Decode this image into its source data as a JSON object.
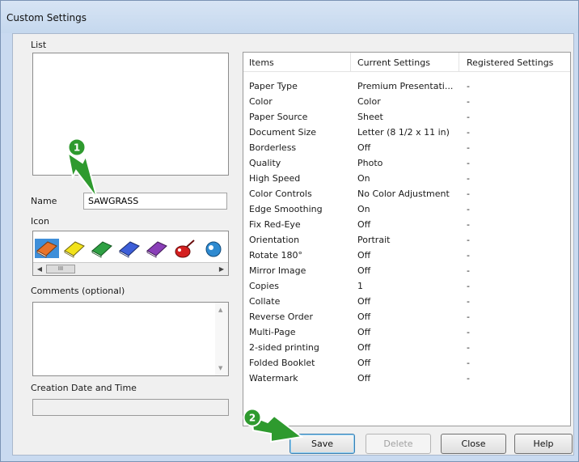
{
  "window": {
    "title": "Custom Settings"
  },
  "left_panel": {
    "list_label": "List",
    "name_label": "Name",
    "name_value": "SAWGRASS",
    "icon_label": "Icon",
    "icons": [
      "orange-book-icon",
      "yellow-book-icon",
      "green-book-icon",
      "blue-book-icon",
      "purple-book-icon",
      "red-watering-can-icon",
      "blue-globe-icon"
    ],
    "comments_label": "Comments (optional)",
    "creation_label": "Creation Date and Time"
  },
  "table": {
    "headers": [
      "Items",
      "Current Settings",
      "Registered Settings"
    ],
    "rows": [
      [
        "Paper Type",
        "Premium Presentati...",
        "-"
      ],
      [
        "Color",
        "Color",
        "-"
      ],
      [
        "Paper Source",
        "Sheet",
        "-"
      ],
      [
        "Document Size",
        "Letter (8 1/2 x 11 in)",
        "-"
      ],
      [
        "Borderless",
        "Off",
        "-"
      ],
      [
        "Quality",
        "Photo",
        "-"
      ],
      [
        "High Speed",
        "On",
        "-"
      ],
      [
        "Color Controls",
        "No Color Adjustment",
        "-"
      ],
      [
        "Edge Smoothing",
        "On",
        "-"
      ],
      [
        "Fix Red-Eye",
        "Off",
        "-"
      ],
      [
        "Orientation",
        "Portrait",
        "-"
      ],
      [
        "Rotate 180°",
        "Off",
        "-"
      ],
      [
        "Mirror Image",
        "Off",
        "-"
      ],
      [
        "Copies",
        "1",
        "-"
      ],
      [
        "Collate",
        "Off",
        "-"
      ],
      [
        "Reverse Order",
        "Off",
        "-"
      ],
      [
        "Multi-Page",
        "Off",
        "-"
      ],
      [
        "2-sided printing",
        "Off",
        "-"
      ],
      [
        "Folded Booklet",
        "Off",
        "-"
      ],
      [
        "Watermark",
        "Off",
        "-"
      ]
    ]
  },
  "buttons": {
    "save": "Save",
    "delete": "Delete",
    "close": "Close",
    "help": "Help"
  },
  "callouts": {
    "step1": "1",
    "step2": "2"
  },
  "colors": {
    "callout_green": "#2e9a2e",
    "selection_blue": "#3f8fd9"
  }
}
